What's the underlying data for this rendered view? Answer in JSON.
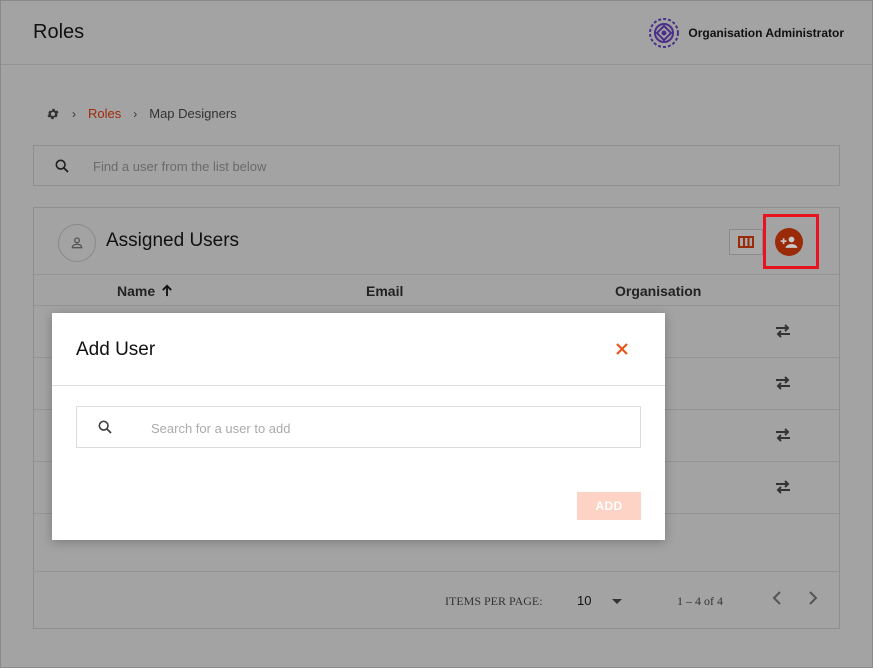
{
  "header": {
    "title": "Roles",
    "org_name": "Organisation Administrator"
  },
  "breadcrumb": {
    "home_icon": "gear-icon",
    "items": [
      "Roles",
      "Map Designers"
    ]
  },
  "search": {
    "placeholder": "Find a user from the list below"
  },
  "card": {
    "title": "Assigned Users",
    "columns": [
      "Name",
      "Email",
      "Organisation"
    ],
    "rows": [
      {},
      {},
      {},
      {}
    ]
  },
  "pagination": {
    "items_per_page_label": "ITEMS PER PAGE:",
    "items_per_page": "10",
    "range": "1 – 4 of 4"
  },
  "modal": {
    "title": "Add User",
    "search_placeholder": "Search for a user to add",
    "add_label": "ADD"
  },
  "colors": {
    "accent": "#e8541e",
    "accent_dim": "#9a2a08",
    "highlight": "#e8131f",
    "add_disabled": "#fcd3c4"
  }
}
